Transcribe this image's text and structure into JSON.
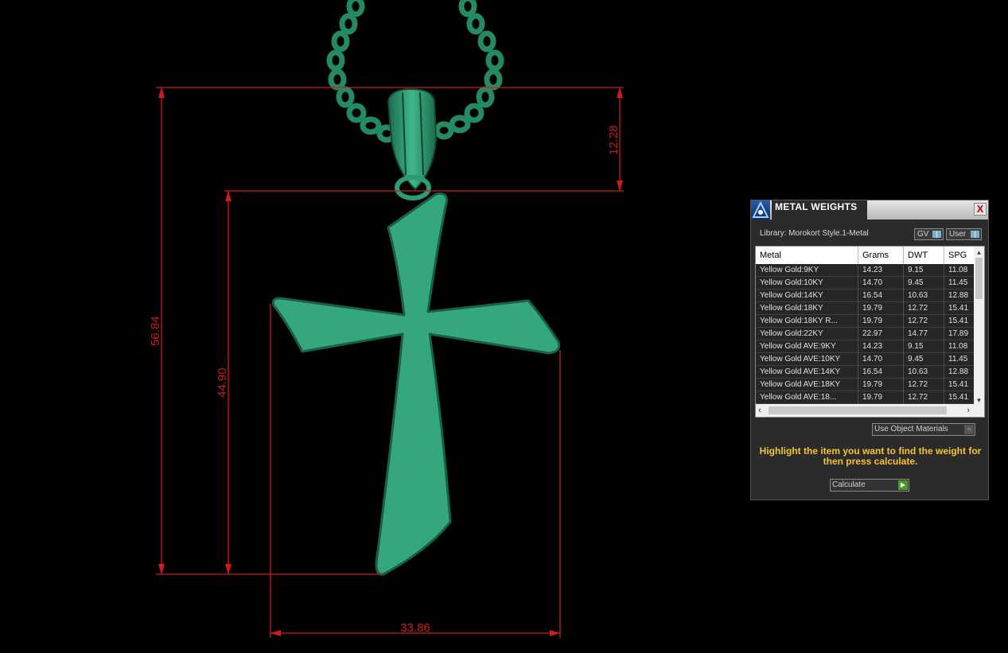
{
  "dimensions": {
    "total_height": "56.84",
    "cross_height": "44.90",
    "bail_height": "12.28",
    "width": "33.86"
  },
  "panel": {
    "title": "METAL WEIGHTS",
    "close_symbol": "X",
    "library_label": "Library: Morokort Style.1-Metal",
    "toggle_gv": "GV",
    "toggle_user": "User",
    "columns": [
      "Metal",
      "Grams",
      "DWT",
      "SPG"
    ],
    "rows": [
      {
        "metal": "Yellow Gold:9KY",
        "grams": "14.23",
        "dwt": "9.15",
        "spg": "11.08"
      },
      {
        "metal": "Yellow Gold:10KY",
        "grams": "14.70",
        "dwt": "9.45",
        "spg": "11.45"
      },
      {
        "metal": "Yellow Gold:14KY",
        "grams": "16.54",
        "dwt": "10.63",
        "spg": "12.88"
      },
      {
        "metal": "Yellow Gold:18KY",
        "grams": "19.79",
        "dwt": "12.72",
        "spg": "15.41"
      },
      {
        "metal": "Yellow Gold:18KY R...",
        "grams": "19.79",
        "dwt": "12.72",
        "spg": "15.41"
      },
      {
        "metal": "Yellow Gold:22KY",
        "grams": "22.97",
        "dwt": "14.77",
        "spg": "17.89"
      },
      {
        "metal": "Yellow Gold AVE:9KY",
        "grams": "14.23",
        "dwt": "9.15",
        "spg": "11.08"
      },
      {
        "metal": "Yellow Gold AVE:10KY",
        "grams": "14.70",
        "dwt": "9.45",
        "spg": "11.45"
      },
      {
        "metal": "Yellow Gold AVE:14KY",
        "grams": "16.54",
        "dwt": "10.63",
        "spg": "12.88"
      },
      {
        "metal": "Yellow Gold AVE:18KY",
        "grams": "19.79",
        "dwt": "12.72",
        "spg": "15.41"
      },
      {
        "metal": "Yellow Gold AVE:18...",
        "grams": "19.79",
        "dwt": "12.72",
        "spg": "15.41"
      }
    ],
    "use_object_materials": "Use Object Materials",
    "hint": "Highlight the item you want to find the weight for then press calculate.",
    "calculate_label": "Calculate"
  },
  "colors": {
    "model": "#34a87c",
    "model_dark": "#1a6a4a",
    "dimension": "#d11a1a",
    "hint": "#f4c430"
  }
}
